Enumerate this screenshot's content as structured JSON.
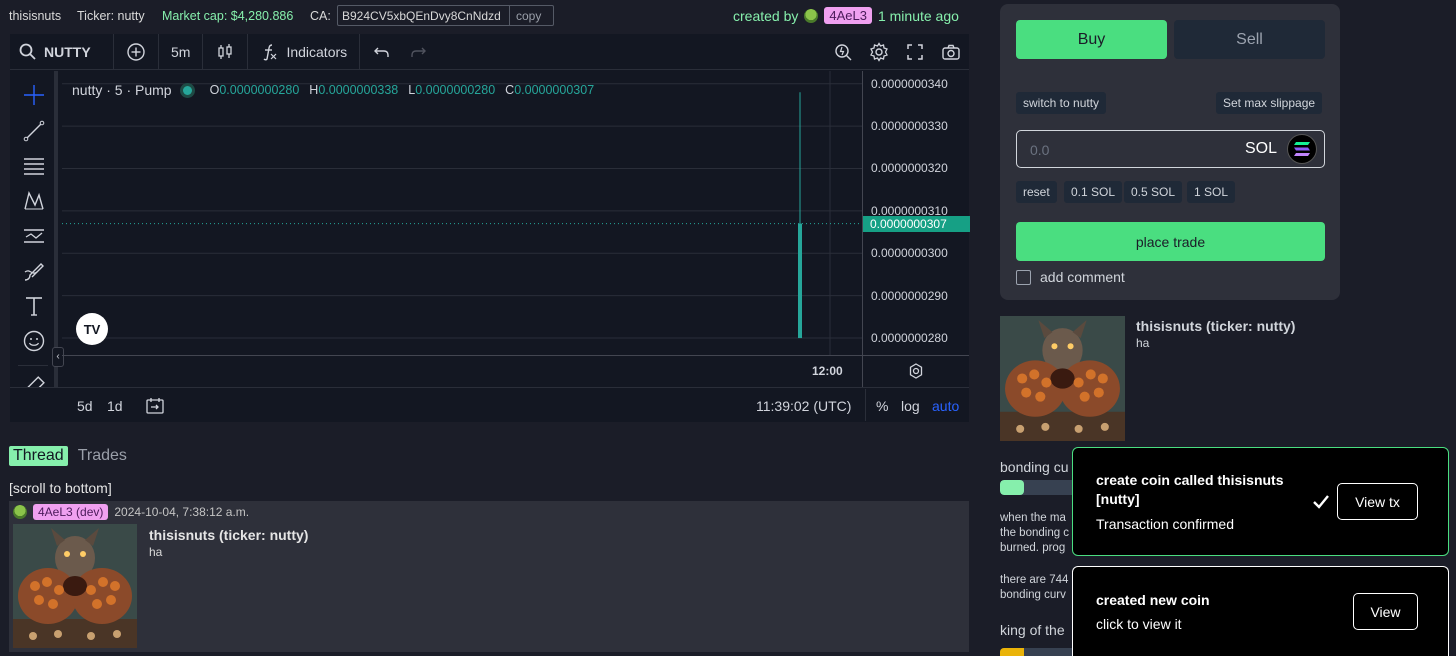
{
  "topbar": {
    "name": "thisisnuts",
    "ticker": "Ticker: nutty",
    "market_cap": "Market cap: $4,280.886",
    "ca_label": "CA:",
    "ca_value": "B924CV5xbQEnDvy8CnNdzd",
    "copy_label": "copy",
    "created_by_label": "created by",
    "creator": "4AeL3",
    "created_time": "1 minute ago"
  },
  "chart_toolbar": {
    "symbol": "NUTTY",
    "interval": "5m",
    "indicators": "Indicators"
  },
  "chart_legend": {
    "title": "nutty · 5 · Pump",
    "o_label": "O",
    "o_value": "0.0000000280",
    "h_label": "H",
    "h_value": "0.0000000338",
    "l_label": "L",
    "l_value": "0.0000000280",
    "c_label": "C",
    "c_value": "0.0000000307"
  },
  "chart_data": {
    "type": "candlestick",
    "price_ticks": [
      "0.0000000340",
      "0.0000000330",
      "0.0000000320",
      "0.0000000310",
      "0.0000000300",
      "0.0000000290",
      "0.0000000280"
    ],
    "price_tick_values": [
      3.4e-08,
      3.3e-08,
      3.2e-08,
      3.1e-08,
      3e-08,
      2.9e-08,
      2.8e-08
    ],
    "ylim": [
      2.76e-08,
      3.43e-08
    ],
    "last_price_label": "0.0000000307",
    "last_price": 3.07e-08,
    "time_tick": "12:00",
    "candles": [
      {
        "open": 2.8e-08,
        "high": 3.38e-08,
        "low": 2.8e-08,
        "close": 3.07e-08
      }
    ],
    "up_color": "#26a69a"
  },
  "chart_bottom": {
    "range_5d": "5d",
    "range_1d": "1d",
    "clock": "11:39:02 (UTC)",
    "percent": "%",
    "log": "log",
    "auto": "auto"
  },
  "thread": {
    "tab_thread": "Thread",
    "tab_trades": "Trades",
    "scroll_link": "[scroll to bottom]",
    "post": {
      "author": "4AeL3 (dev)",
      "timestamp": "2024-10-04, 7:38:12 a.m.",
      "title": "thisisnuts (ticker: nutty)",
      "body": "ha"
    }
  },
  "trade": {
    "buy": "Buy",
    "sell": "Sell",
    "switch": "switch to nutty",
    "max_slippage": "Set max slippage",
    "amount_placeholder": "0.0",
    "currency": "SOL",
    "presets": [
      "reset",
      "0.1 SOL",
      "0.5 SOL",
      "1 SOL"
    ],
    "place_trade": "place trade",
    "add_comment": "add comment"
  },
  "coin": {
    "title": "thisisnuts (ticker: nutty)",
    "description": "ha",
    "bonding_label": "bonding cu",
    "bonding_progress": 0.24,
    "info1_l1": "when the ma",
    "info1_l2": "the bonding c",
    "info1_l3": "burned. prog",
    "info2_l1": "there are 744",
    "info2_l2": "bonding curv",
    "koth_label": "king of the"
  },
  "toasts": [
    {
      "title": "create coin called thisisnuts [nutty]",
      "subtitle": "Transaction confirmed",
      "button": "View tx"
    },
    {
      "title": "created new coin",
      "subtitle": "click to view it",
      "button": "View"
    }
  ],
  "colors": {
    "accent_green": "#4ade80",
    "candle_up": "#26a69a",
    "creator_badge": "#f0a0f0"
  }
}
